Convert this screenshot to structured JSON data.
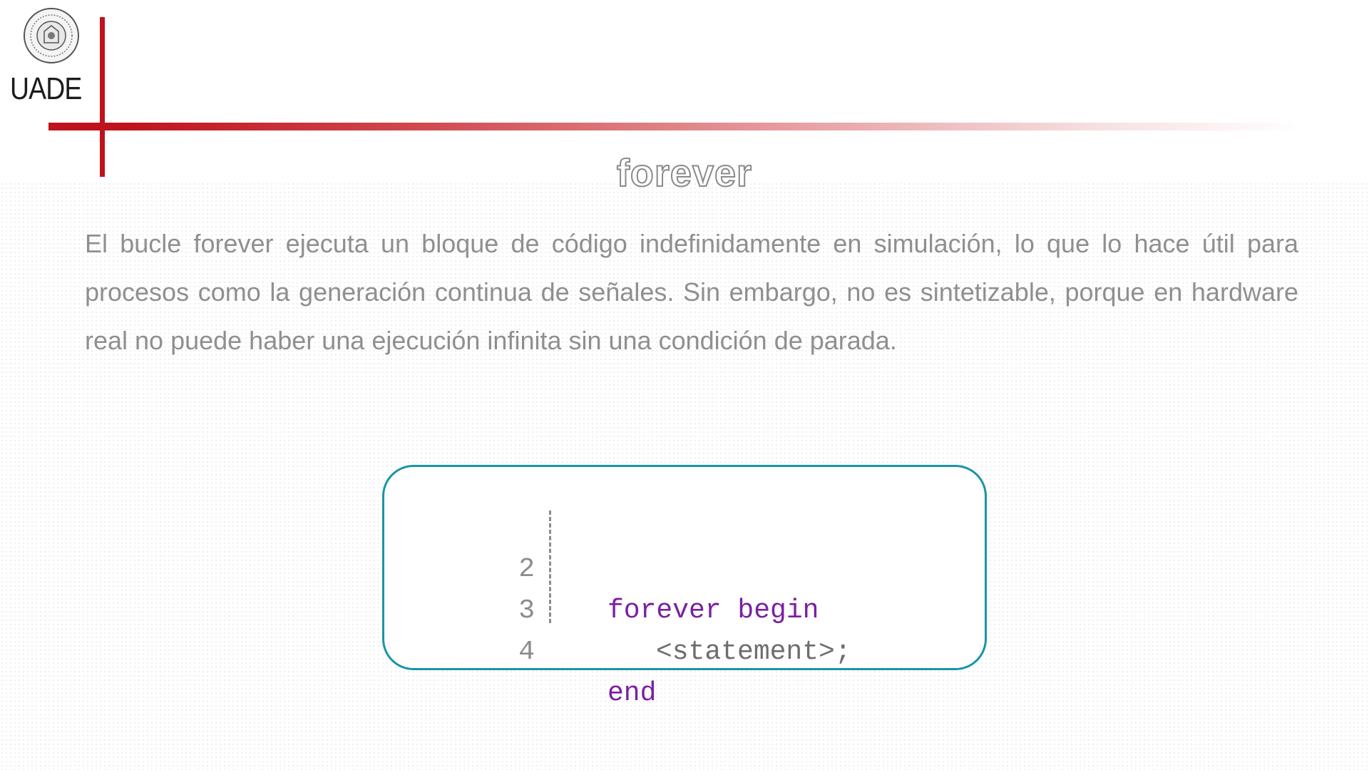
{
  "logo": {
    "text": "UADE"
  },
  "slide": {
    "title": "forever",
    "paragraph": "El bucle forever ejecuta un bloque de código indefinidamente en simulación, lo que lo hace útil para procesos como la generación continua de señales. Sin embargo, no es sintetizable, porque en hardware real no puede haber una ejecución infinita sin una condición de parada."
  },
  "code": {
    "lines": [
      {
        "number": "2",
        "text": "forever begin"
      },
      {
        "number": "3",
        "text": "<statement>;"
      },
      {
        "number": "4",
        "text": "end"
      }
    ]
  },
  "colors": {
    "accent_red": "#c0121c",
    "box_border": "#1a94a8",
    "keyword": "#7b1fa2"
  }
}
